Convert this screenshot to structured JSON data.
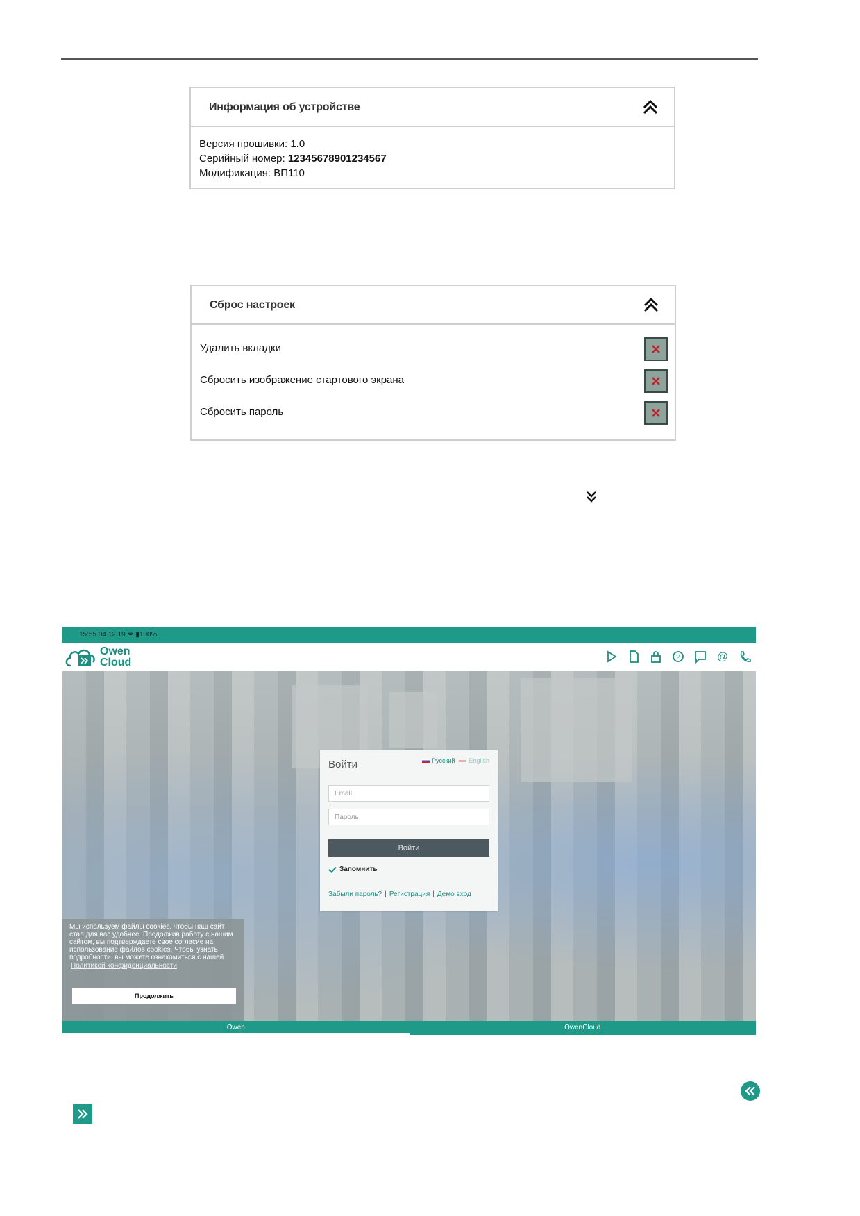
{
  "device_info": {
    "title": "Информация об устройстве",
    "firmware_label": "Версия прошивки:",
    "firmware_value": "1.0",
    "serial_label": "Серийный номер:",
    "serial_value": "12345678901234567",
    "modification_label": "Модификация:",
    "modification_value": "ВП110"
  },
  "reset": {
    "title": "Сброс настроек",
    "items": [
      {
        "label": "Удалить вкладки"
      },
      {
        "label": "Сбросить изображение стартового экрана"
      },
      {
        "label": "Сбросить пароль"
      }
    ]
  },
  "app": {
    "statusbar": "15:55 04.12.19 ᯤ ▮100%",
    "logo": {
      "line1": "Owen",
      "line2": "Cloud"
    },
    "header_icons": [
      "play-icon",
      "document-icon",
      "lock-icon",
      "help-icon",
      "chat-icon",
      "at-icon",
      "phone-icon"
    ],
    "login": {
      "title": "Войти",
      "lang_ru": "Русский",
      "lang_en": "English",
      "email_placeholder": "Email",
      "password_placeholder": "Пароль",
      "submit": "Войти",
      "remember": "Запомнить",
      "forgot": "Забыли пароль?",
      "register": "Регистрация",
      "demo": "Демо вход",
      "sep": "|"
    },
    "cookie": {
      "text": "Мы используем файлы cookies, чтобы наш сайт стал для вас удобнее. Продолжив работу с нашим сайтом, вы подтверждаете свое согласие на использование файлов cookies. Чтобы узнать подробности, вы можете ознакомиться с нашей",
      "link": "Политикой конфиденциальности",
      "button": "Продолжить"
    },
    "tabs": [
      {
        "label": "Owen",
        "active": true
      },
      {
        "label": "OwenCloud",
        "active": false
      }
    ]
  },
  "colors": {
    "accent": "#1f9a88",
    "reset_button": "#8fa39d",
    "reset_x": "#c0202a"
  }
}
